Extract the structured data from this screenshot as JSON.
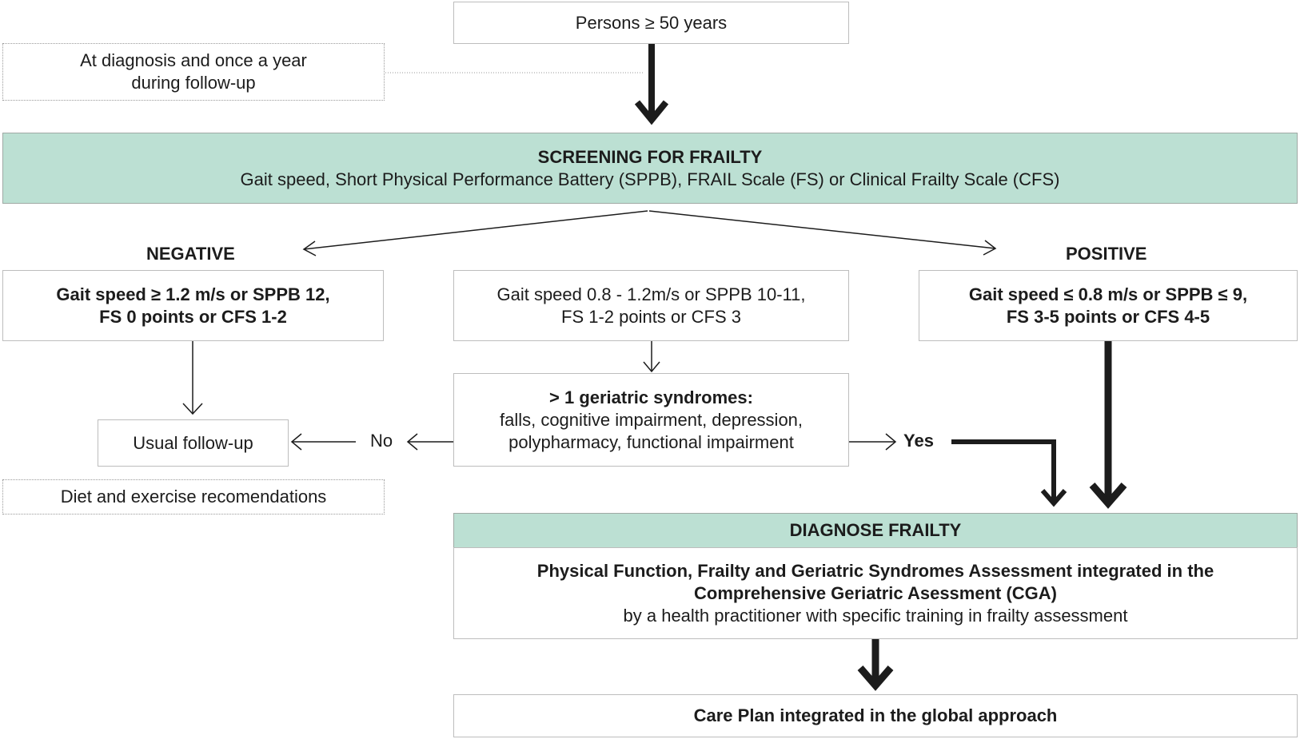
{
  "colors": {
    "screening_fill": "#bce0d3",
    "arrow": "#1c1c1c",
    "box_border": "#bdbdbd"
  },
  "start": {
    "text": "Persons ≥ 50 years"
  },
  "timing_note": {
    "line1": "At diagnosis and once a year",
    "line2": "during follow-up"
  },
  "screening": {
    "title": "SCREENING FOR FRAILTY",
    "subtitle": "Gait speed, Short Physical Performance Battery (SPPB), FRAIL Scale (FS) or Clinical Frailty Scale (CFS)"
  },
  "negative": {
    "label": "NEGATIVE",
    "line1": "Gait speed ≥ 1.2 m/s or SPPB 12,",
    "line2": "FS 0 points or CFS 1-2"
  },
  "intermediate": {
    "line1": "Gait speed 0.8 - 1.2m/s or SPPB 10-11,",
    "line2": "FS 1-2 points or CFS 3"
  },
  "positive": {
    "label": "POSITIVE",
    "line1": "Gait speed ≤ 0.8 m/s or SPPB ≤ 9,",
    "line2": "FS 3-5 points or CFS 4-5"
  },
  "geriatric": {
    "title": "> 1 geriatric syndromes:",
    "line1": "falls, cognitive impairment, depression,",
    "line2": "polypharmacy, functional impairment"
  },
  "no_label": "No",
  "yes_label": "Yes",
  "usual_followup": {
    "text": "Usual follow-up"
  },
  "diet_note": {
    "text": "Diet and exercise recomendations"
  },
  "diagnose": {
    "title": "DIAGNOSE FRAILTY",
    "line1": "Physical Function, Frailty and Geriatric Syndromes Assessment integrated in the",
    "line2": "Comprehensive Geriatric Asessment (CGA)",
    "line3": "by a health practitioner with specific training in frailty assessment"
  },
  "care_plan": {
    "text": "Care Plan integrated in the global approach"
  }
}
